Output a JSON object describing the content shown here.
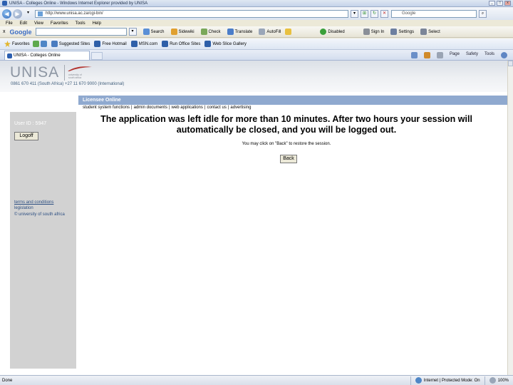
{
  "window": {
    "title": "UNISA - Colleges Online - Windows Internet Explorer provided by UNISA",
    "buttons": [
      "_",
      "□",
      "x"
    ]
  },
  "address": {
    "url": "http://www.unisa.ac.za/cgi-bin/",
    "search_value": "Google"
  },
  "menu": [
    "File",
    "Edit",
    "View",
    "Favorites",
    "Tools",
    "Help"
  ],
  "google_toolbar": {
    "close": "x",
    "logo": "Google",
    "items": [
      "Search",
      "Sidewiki",
      "Check",
      "Translate",
      "AutoFill",
      "Sign In",
      "Settings",
      "Select"
    ],
    "extra": "Disabled"
  },
  "favorites": {
    "label": "Favorites",
    "items": [
      "Suggested Sites",
      "Free Hotmail",
      "MSN.com",
      "Run Office Sites",
      "Web Slice Gallery"
    ]
  },
  "tab": {
    "label": "UNISA - Colleges Online"
  },
  "command_bar": [
    "Page",
    "Safety",
    "Tools"
  ],
  "site": {
    "logo": "UNISA",
    "tagline": "university of south africa",
    "phone": "0861 670 411 (South Africa) +27 11 670 9000 (International)",
    "licensee": "Licensee Online",
    "nav": [
      "student system functions",
      "admin documents",
      "web applications",
      "contact us",
      "advertising"
    ]
  },
  "panel": {
    "user_id": "User ID : 5947",
    "logoff": "Logoff",
    "links": [
      "terms and conditions",
      "legislation"
    ],
    "copyright": "© university of south africa"
  },
  "message": {
    "main": "The application was left idle for more than 10 minutes. After two hours your session will automatically be closed, and you will be logged out.",
    "hint": "You may click on \"Back\" to restore the session.",
    "back": "Back"
  },
  "status": {
    "left": "Done",
    "zone": "Internet | Protected Mode: On",
    "zoom": "100%"
  },
  "colors": {
    "licensee_bar": "#8fa9cf",
    "left_panel": "#d2d2d2",
    "logo_grey": "#8d96a3",
    "logo_red": "#b3342f"
  }
}
